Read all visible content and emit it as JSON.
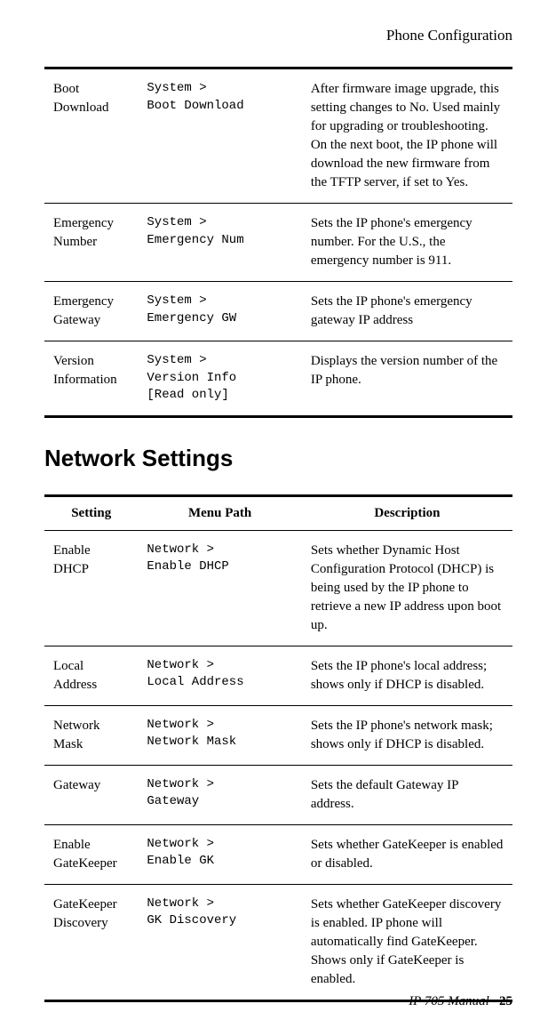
{
  "header": "Phone Configuration",
  "table1": {
    "rows": [
      {
        "setting": "Boot Download",
        "path": "System >\nBoot Download",
        "desc": "After firmware image upgrade, this setting changes to No. Used mainly for upgrading or troubleshooting. On the next boot, the IP phone will download the new firmware from the TFTP server, if set to Yes."
      },
      {
        "setting": "Emergency Number",
        "path": "System >\nEmergency Num",
        "desc": "Sets the IP phone's emergency number. For the U.S., the emergency number is 911."
      },
      {
        "setting": "Emergency Gateway",
        "path": "System >\nEmergency GW",
        "desc": "Sets the IP phone's emergency gateway IP address"
      },
      {
        "setting": "Version Information",
        "path": "System >\nVersion Info\n[Read only]",
        "desc": "Displays the version number of the IP phone."
      }
    ]
  },
  "section_heading": "Network Settings",
  "table2": {
    "headers": {
      "setting": "Setting",
      "path": "Menu Path",
      "desc": "Description"
    },
    "rows": [
      {
        "setting": "Enable DHCP",
        "path": "Network >\nEnable DHCP",
        "desc": "Sets whether Dynamic Host Configuration Protocol (DHCP) is being used by the IP phone to retrieve a new IP address upon boot up."
      },
      {
        "setting": "Local Address",
        "path": "Network >\nLocal Address",
        "desc": "Sets the IP phone's local address; shows only if DHCP is disabled."
      },
      {
        "setting": "Network Mask",
        "path": "Network >\nNetwork Mask",
        "desc": "Sets the IP phone's network mask; shows only if DHCP is disabled."
      },
      {
        "setting": "Gateway",
        "path": "Network >\nGateway",
        "desc": "Sets the default Gateway IP address."
      },
      {
        "setting": "Enable GateKeeper",
        "path": "Network >\nEnable GK",
        "desc": "Sets whether GateKeeper is enabled or disabled."
      },
      {
        "setting": "GateKeeper Discovery",
        "path": "Network >\nGK Discovery",
        "desc": "Sets whether GateKeeper discovery is enabled. IP phone will automatically find GateKeeper. Shows only if GateKeeper is enabled."
      }
    ]
  },
  "footer": {
    "title": "IP 705 Manual",
    "page": "25"
  }
}
